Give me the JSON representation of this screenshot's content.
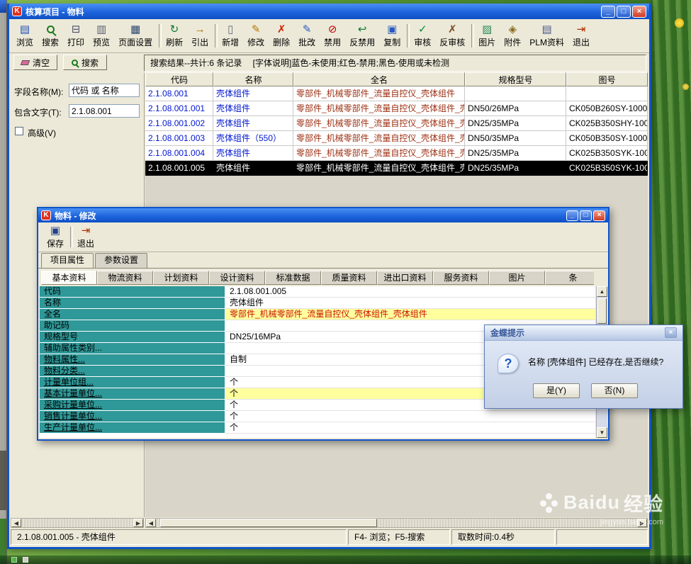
{
  "app_logo": "K",
  "icons": {
    "minimize": "_",
    "maximize": "□",
    "close": "×",
    "arrow_left": "◀",
    "arrow_right": "▶",
    "arrow_up": "▲",
    "arrow_down": "▼",
    "question": "?"
  },
  "main_window": {
    "title": "核算项目 - 物料",
    "toolbar": [
      {
        "name": "toolbar-button-browse",
        "label": "浏览",
        "glyph": "▤",
        "icon_css": "color:#1d4eb5"
      },
      {
        "name": "toolbar-button-search",
        "label": "搜索",
        "glyph": "",
        "icon_variant": "mag"
      },
      {
        "name": "toolbar-button-print",
        "label": "打印",
        "glyph": "⊟",
        "icon_css": "color:#4a4f66"
      },
      {
        "name": "toolbar-button-preview",
        "label": "预览",
        "glyph": "▥",
        "icon_css": "color:#5a6070"
      },
      {
        "name": "toolbar-button-page-setup",
        "label": "页面设置",
        "glyph": "▦",
        "icon_css": "color:#28446e"
      },
      {
        "name": "toolbar-separator",
        "type": "sep",
        "inter": "false"
      },
      {
        "name": "toolbar-button-refresh",
        "label": "刷新",
        "glyph": "↻",
        "icon_css": "color:#0a7a2f"
      },
      {
        "name": "toolbar-button-export",
        "label": "引出",
        "glyph": "→",
        "icon_css": "color:#b06a00"
      },
      {
        "name": "toolbar-separator",
        "type": "sep",
        "inter": "false"
      },
      {
        "name": "toolbar-button-new",
        "label": "新增",
        "glyph": "▯",
        "icon_css": "color:#60697a"
      },
      {
        "name": "toolbar-button-modify",
        "label": "修改",
        "glyph": "✎",
        "icon_css": "color:#b07800"
      },
      {
        "name": "toolbar-button-delete",
        "label": "删除",
        "glyph": "✗",
        "icon_css": "color:#cc2200"
      },
      {
        "name": "toolbar-button-batch-edit",
        "label": "批改",
        "glyph": "✎",
        "icon_css": "color:#2a5ac0"
      },
      {
        "name": "toolbar-button-disable",
        "label": "禁用",
        "glyph": "⊘",
        "icon_css": "color:#c40000"
      },
      {
        "name": "toolbar-button-enable",
        "label": "反禁用",
        "glyph": "↩",
        "icon_css": "color:#0a7a2f"
      },
      {
        "name": "toolbar-button-copy",
        "label": "复制",
        "glyph": "▣",
        "icon_css": "color:#2a5ac0"
      },
      {
        "name": "toolbar-separator",
        "type": "sep",
        "inter": "false"
      },
      {
        "name": "toolbar-button-approve",
        "label": "审核",
        "glyph": "✓",
        "icon_css": "color:#0a8a2f"
      },
      {
        "name": "toolbar-button-unapprove",
        "label": "反审核",
        "glyph": "✗",
        "icon_css": "color:#7a4a20"
      },
      {
        "name": "toolbar-separator",
        "type": "sep",
        "inter": "false"
      },
      {
        "name": "toolbar-button-picture",
        "label": "图片",
        "glyph": "▨",
        "icon_css": "color:#2a8a5a"
      },
      {
        "name": "toolbar-button-attachment",
        "label": "附件",
        "glyph": "◈",
        "icon_css": "color:#8a6a20"
      },
      {
        "name": "toolbar-button-plm",
        "label": "PLM资料",
        "glyph": "▤",
        "icon_css": "color:#4a5a8a"
      },
      {
        "name": "toolbar-button-exit",
        "label": "退出",
        "glyph": "⇥",
        "icon_css": "color:#b03000"
      }
    ],
    "search_bar": {
      "clear_label": "清空",
      "search_label": "搜索",
      "result_text": "搜索结果--共计:6 条记录　 [字体说明]蓝色-未使用;红色-禁用;黑色-使用或未检测"
    },
    "filter": {
      "field_label": "字段名称(M):",
      "field_value": "代码 或 名称",
      "contains_label": "包含文字(T):",
      "contains_value": "2.1.08.001",
      "advanced_label": "高级(V)"
    },
    "table": {
      "columns": [
        "代码",
        "名称",
        "全名",
        "规格型号",
        "图号"
      ],
      "rows": [
        {
          "code": "2.1.08.001",
          "name": "壳体组件",
          "fullname": "零部件_机械零部件_流量自控仪_壳体组件",
          "spec": "",
          "drawing": ""
        },
        {
          "code": "2.1.08.001.001",
          "name": "壳体组件",
          "fullname": "零部件_机械零部件_流量自控仪_壳体组件_壳",
          "spec": "DN50/26MPa",
          "drawing": "CK050B260SY-1000"
        },
        {
          "code": "2.1.08.001.002",
          "name": "壳体组件",
          "fullname": "零部件_机械零部件_流量自控仪_壳体组件_壳",
          "spec": "DN25/35MPa",
          "drawing": "CK025B350SHY-100"
        },
        {
          "code": "2.1.08.001.003",
          "name": "壳体组件（550）",
          "fullname": "零部件_机械零部件_流量自控仪_壳体组件_壳",
          "spec": "DN50/35MPa",
          "drawing": "CK050B350SY-1000"
        },
        {
          "code": "2.1.08.001.004",
          "name": "壳体组件",
          "fullname": "零部件_机械零部件_流量自控仪_壳体组件_壳",
          "spec": "DN25/35MPa",
          "drawing": "CK025B350SYK-100"
        },
        {
          "code": "2.1.08.001.005",
          "name": "壳体组件",
          "fullname": "零部件_机械零部件_流量自控仪_壳体组件_壳",
          "spec": "DN25/35MPa",
          "drawing": "CK025B350SYK-100",
          "variant": "selected"
        }
      ]
    },
    "status_bar": {
      "selection": "2.1.08.001.005 - 壳体组件",
      "hotkeys": "F4- 浏览；F5-搜索",
      "timing": "取数时间:0.4秒"
    }
  },
  "edit_window": {
    "title": "物料 - 修改",
    "toolbar": [
      {
        "name": "edit-toolbar-button-save",
        "label": "保存",
        "glyph": "▣",
        "icon_css": "color:#24418c"
      },
      {
        "name": "toolbar-separator",
        "type": "sep",
        "inter": "false"
      },
      {
        "name": "edit-toolbar-button-exit",
        "label": "退出",
        "glyph": "⇥",
        "icon_css": "color:#b03000"
      }
    ],
    "tabs": [
      {
        "name": "tab-item-properties",
        "label": "项目属性",
        "variant": "active"
      },
      {
        "name": "tab-parameter-settings",
        "label": "参数设置"
      }
    ],
    "sub_tabs": [
      {
        "name": "subtab-basic-info",
        "label": "基本资料",
        "variant": "active"
      },
      {
        "name": "subtab-logistics",
        "label": "物流资料"
      },
      {
        "name": "subtab-planning",
        "label": "计划资料"
      },
      {
        "name": "subtab-design",
        "label": "设计资料"
      },
      {
        "name": "subtab-standard-data",
        "label": "标准数据"
      },
      {
        "name": "subtab-quality",
        "label": "质量资料"
      },
      {
        "name": "subtab-import-export",
        "label": "进出口资料"
      },
      {
        "name": "subtab-service",
        "label": "服务资料"
      },
      {
        "name": "subtab-picture",
        "label": "图片"
      },
      {
        "name": "subtab-barcode",
        "label": "条"
      }
    ],
    "fields": [
      {
        "label": "代码",
        "value": "2.1.08.001.005"
      },
      {
        "label": "名称",
        "value": "壳体组件"
      },
      {
        "label": "全名",
        "value": "零部件_机械零部件_流量自控仪_壳体组件_壳体组件",
        "variant": "redhl"
      },
      {
        "label": "助记码",
        "value": ""
      },
      {
        "label": "规格型号",
        "value": "DN25/16MPa"
      },
      {
        "label": "辅助属性类别...",
        "value": ""
      },
      {
        "label": "物料属性...",
        "value": "自制",
        "link": "true"
      },
      {
        "label": "物料分类...",
        "value": "",
        "link": "true"
      },
      {
        "label": "计量单位组...",
        "value": "个",
        "link": "true"
      },
      {
        "label": "基本计量单位...",
        "value": "个",
        "variant": "hl",
        "link": "true"
      },
      {
        "label": "采购计量单位...",
        "value": "个",
        "link": "true"
      },
      {
        "label": "销售计量单位...",
        "value": "个",
        "link": "true"
      },
      {
        "label": "生产计量单位...",
        "value": "个",
        "link": "true"
      }
    ]
  },
  "prompt_dialog": {
    "title": "金蝶提示",
    "message": "名称 [壳体组件] 已经存在,是否继续?",
    "yes_label": "是(Y)",
    "no_label": "否(N)"
  },
  "watermark": {
    "brand": "Baidu",
    "suffix": "经验",
    "subtext": "jingyan.baidu.com"
  }
}
